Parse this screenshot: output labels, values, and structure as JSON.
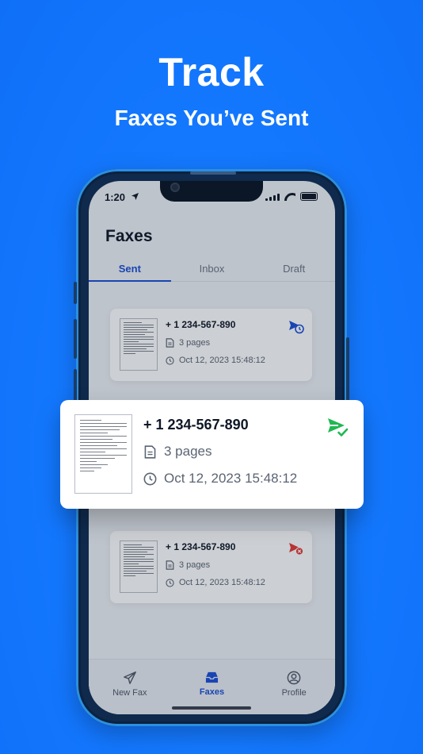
{
  "promo": {
    "headline": "Track",
    "subline": "Faxes You’ve Sent"
  },
  "status_bar": {
    "time": "1:20"
  },
  "app": {
    "title": "Faxes"
  },
  "tabs": [
    {
      "label": "Sent",
      "active": true
    },
    {
      "label": "Inbox",
      "active": false
    },
    {
      "label": "Draft",
      "active": false
    }
  ],
  "faxes": [
    {
      "number": "+ 1 234-567-890",
      "pages": "3 pages",
      "timestamp": "Oct 12, 2023 15:48:12",
      "status": "scheduled",
      "status_icon": "send-clock-icon",
      "status_color": "#1a4fd6"
    },
    {
      "number": "+ 1 234-567-890",
      "pages": "3 pages",
      "timestamp": "Oct 12, 2023 15:48:12",
      "status": "sent",
      "status_icon": "send-check-icon",
      "status_color": "#1fb851"
    },
    {
      "number": "+ 1 234-567-890",
      "pages": "3 pages",
      "timestamp": "Oct 12, 2023 15:48:12",
      "status": "failed",
      "status_icon": "send-error-icon",
      "status_color": "#e53935"
    }
  ],
  "bottom_nav": [
    {
      "label": "New Fax",
      "icon": "paper-plane-icon",
      "active": false
    },
    {
      "label": "Faxes",
      "icon": "inbox-icon",
      "active": true
    },
    {
      "label": "Profile",
      "icon": "user-circle-icon",
      "active": false
    }
  ],
  "colors": {
    "background": "#1479ff",
    "accent": "#1a4fd6"
  }
}
